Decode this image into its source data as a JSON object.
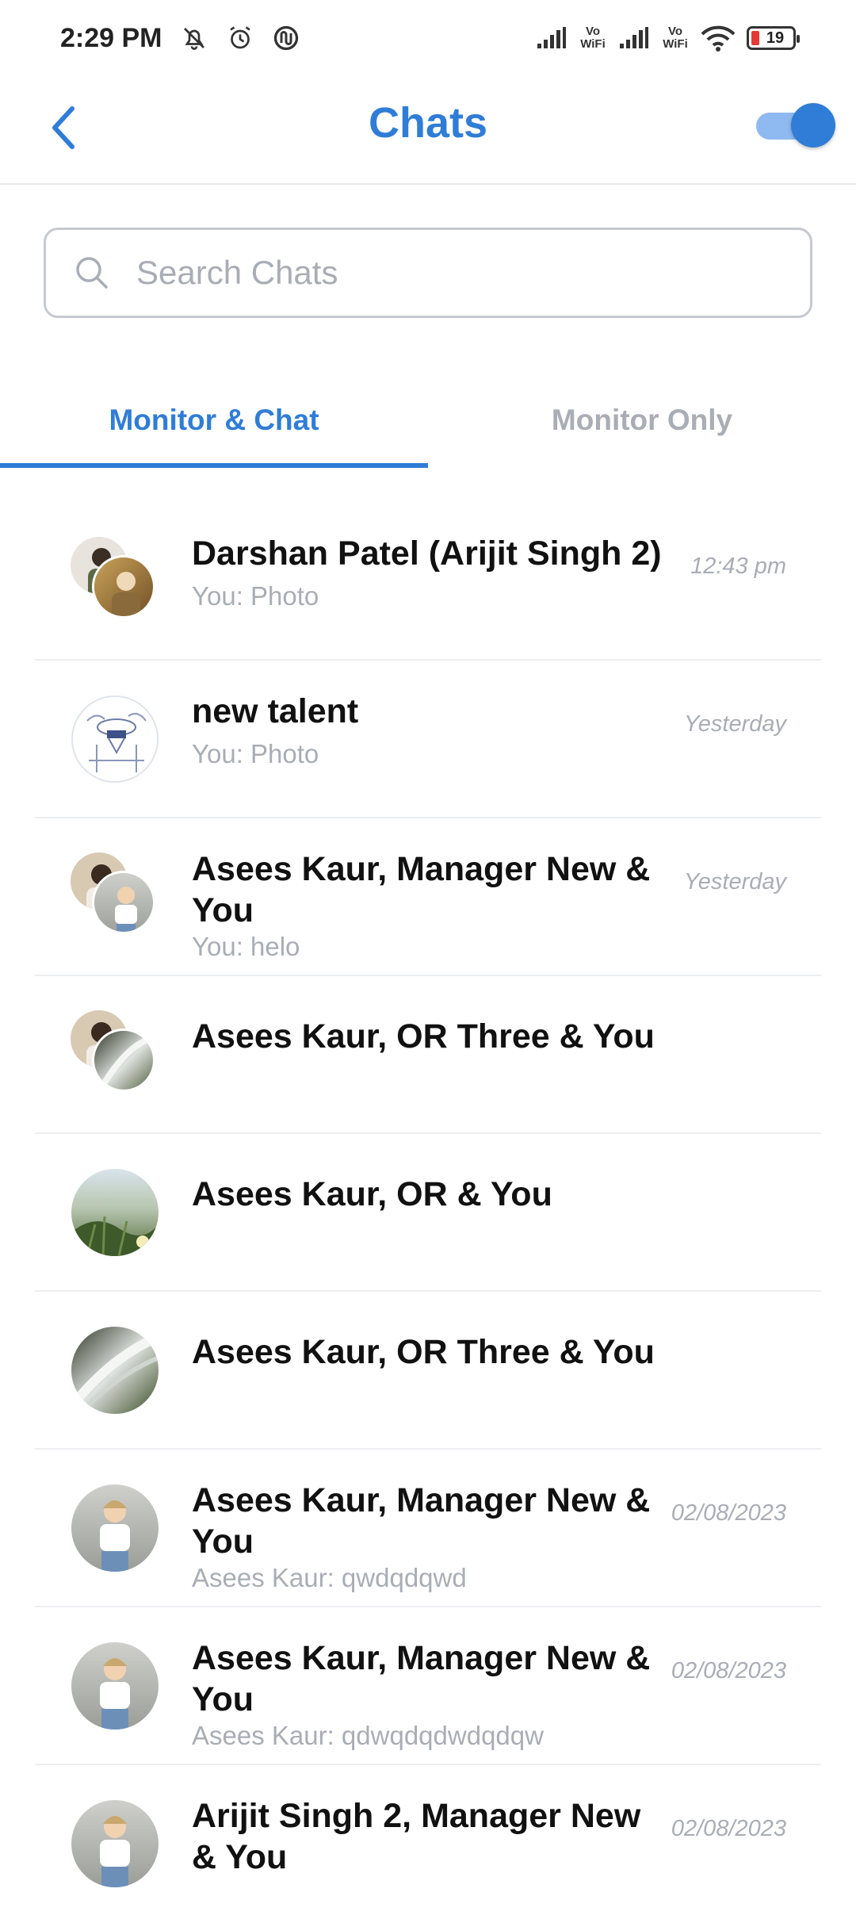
{
  "status_bar": {
    "time": "2:29 PM",
    "icons_left": [
      "mute-bell-icon",
      "alarm-icon",
      "app-notification-icon"
    ],
    "vowifi_label": "Vo WiFi",
    "battery": "19"
  },
  "header": {
    "title": "Chats",
    "back_icon": "chevron-left-icon",
    "toggle_on": true,
    "accent": "#2f7dd6"
  },
  "search": {
    "placeholder": "Search Chats",
    "value": ""
  },
  "tabs": [
    {
      "label": "Monitor & Chat",
      "active": true
    },
    {
      "label": "Monitor Only",
      "active": false
    }
  ],
  "chats": [
    {
      "name": "Darshan Patel (Arijit Singh 2)",
      "preview": "You: Photo",
      "time": "12:43 pm",
      "avatar": "group"
    },
    {
      "name": "new talent",
      "preview": "You: Photo",
      "time": "Yesterday",
      "avatar": "sketch"
    },
    {
      "name": "Asees Kaur, Manager New & You",
      "preview": "You: helo",
      "time": "Yesterday",
      "avatar": "group"
    },
    {
      "name": "Asees Kaur, OR Three & You",
      "preview": "",
      "time": "",
      "avatar": "group"
    },
    {
      "name": "Asees Kaur, OR & You",
      "preview": "",
      "time": "",
      "avatar": "nature"
    },
    {
      "name": "Asees Kaur, OR Three & You",
      "preview": "",
      "time": "",
      "avatar": "waterfall"
    },
    {
      "name": "Asees Kaur, Manager New & You",
      "preview": "Asees Kaur: qwdqdqwd",
      "time": "02/08/2023",
      "avatar": "person"
    },
    {
      "name": "Asees Kaur, Manager New & You",
      "preview": "Asees Kaur: qdwqdqdwdqdqw",
      "time": "02/08/2023",
      "avatar": "person"
    },
    {
      "name": "Arijit Singh 2, Manager New & You",
      "preview": "",
      "time": "02/08/2023",
      "avatar": "person"
    }
  ]
}
